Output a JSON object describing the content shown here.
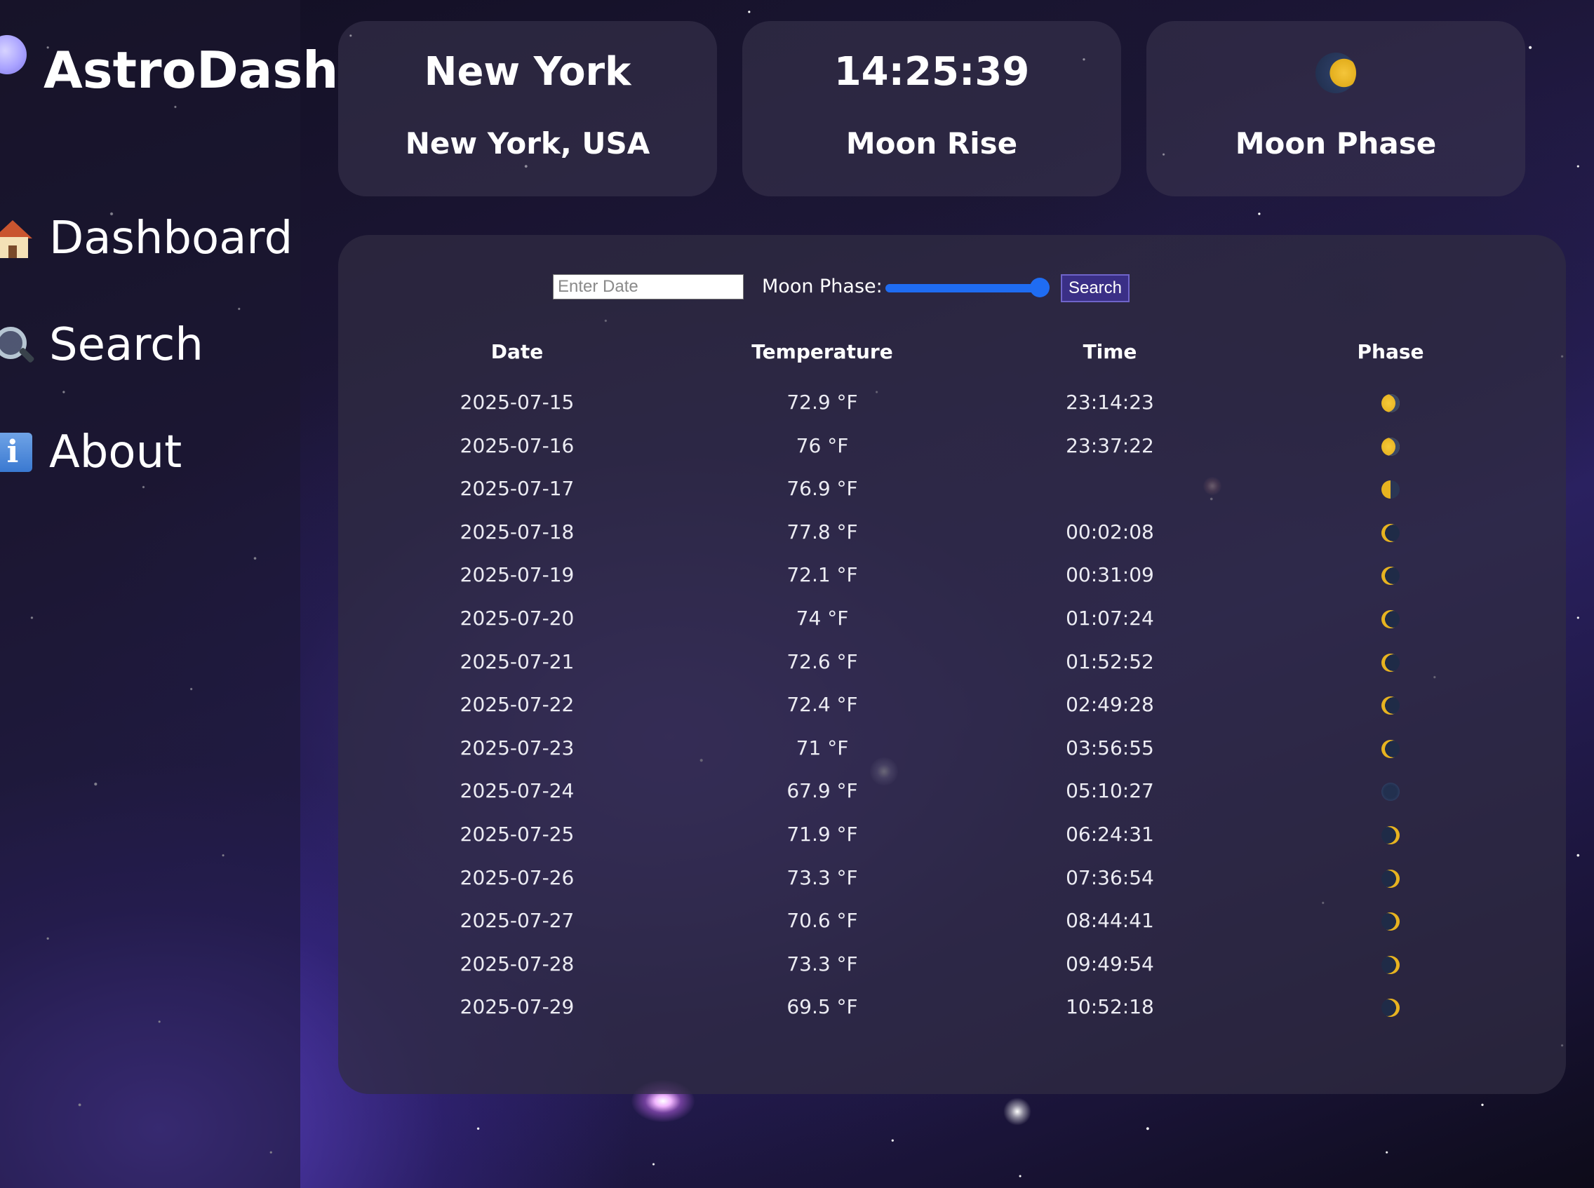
{
  "app": {
    "name": "AstroDash"
  },
  "sidebar": {
    "items": [
      {
        "label": "Dashboard",
        "icon": "house-icon"
      },
      {
        "label": "Search",
        "icon": "magnifier-icon"
      },
      {
        "label": "About",
        "icon": "info-icon"
      }
    ]
  },
  "cards": [
    {
      "top": "New York",
      "bottom": "New York, USA"
    },
    {
      "top": "14:25:39",
      "bottom": "Moon Rise"
    },
    {
      "top_icon": "moon-phase-icon",
      "bottom": "Moon Phase"
    }
  ],
  "controls": {
    "date_placeholder": "Enter Date",
    "moon_phase_label": "Moon Phase:",
    "slider_value": 1.0,
    "search_label": "Search"
  },
  "table": {
    "headers": [
      "Date",
      "Temperature",
      "Time",
      "Phase"
    ],
    "rows": [
      {
        "date": "2025-07-15",
        "temp": "72.9 °F",
        "time": "23:14:23",
        "phase": "waxing-gibbous"
      },
      {
        "date": "2025-07-16",
        "temp": "76 °F",
        "time": "23:37:22",
        "phase": "waxing-gibbous"
      },
      {
        "date": "2025-07-17",
        "temp": "76.9 °F",
        "time": "",
        "phase": "last-quarter"
      },
      {
        "date": "2025-07-18",
        "temp": "77.8 °F",
        "time": "00:02:08",
        "phase": "waning-crescent"
      },
      {
        "date": "2025-07-19",
        "temp": "72.1 °F",
        "time": "00:31:09",
        "phase": "waning-crescent"
      },
      {
        "date": "2025-07-20",
        "temp": "74 °F",
        "time": "01:07:24",
        "phase": "waning-crescent"
      },
      {
        "date": "2025-07-21",
        "temp": "72.6 °F",
        "time": "01:52:52",
        "phase": "waning-crescent"
      },
      {
        "date": "2025-07-22",
        "temp": "72.4 °F",
        "time": "02:49:28",
        "phase": "waning-crescent"
      },
      {
        "date": "2025-07-23",
        "temp": "71 °F",
        "time": "03:56:55",
        "phase": "waning-crescent"
      },
      {
        "date": "2025-07-24",
        "temp": "67.9 °F",
        "time": "05:10:27",
        "phase": "new-moon"
      },
      {
        "date": "2025-07-25",
        "temp": "71.9 °F",
        "time": "06:24:31",
        "phase": "waxing-crescent"
      },
      {
        "date": "2025-07-26",
        "temp": "73.3 °F",
        "time": "07:36:54",
        "phase": "waxing-crescent"
      },
      {
        "date": "2025-07-27",
        "temp": "70.6 °F",
        "time": "08:44:41",
        "phase": "waxing-crescent"
      },
      {
        "date": "2025-07-28",
        "temp": "73.3 °F",
        "time": "09:49:54",
        "phase": "waxing-crescent"
      },
      {
        "date": "2025-07-29",
        "temp": "69.5 °F",
        "time": "10:52:18",
        "phase": "waxing-crescent"
      }
    ]
  },
  "colors": {
    "accent": "#1f6cf2",
    "button": "#3a2f86",
    "moon_gold": "#e7b320",
    "moon_dark": "#1f2b47"
  }
}
